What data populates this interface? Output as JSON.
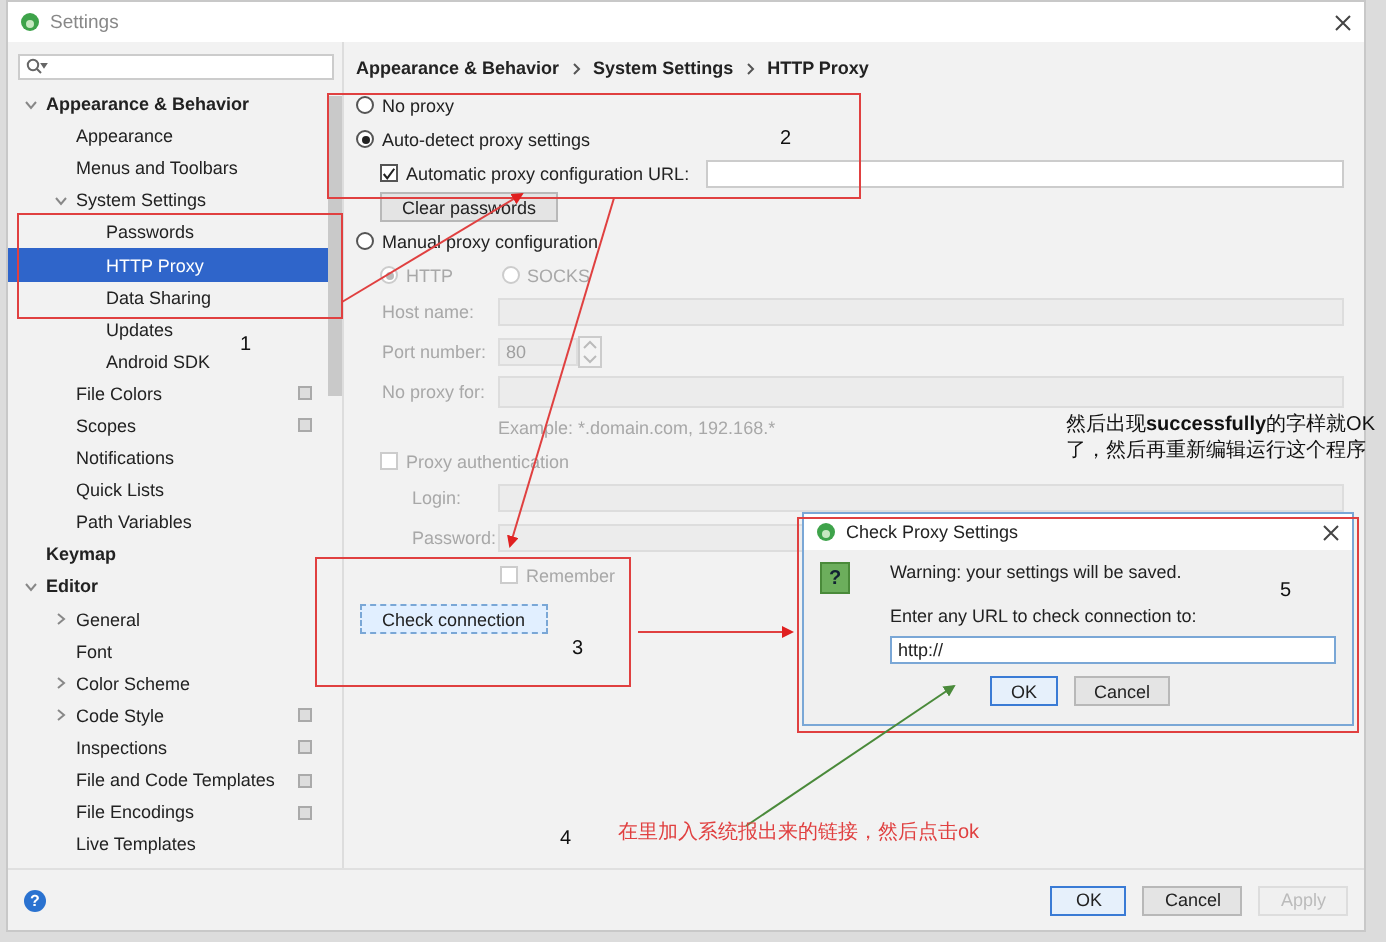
{
  "window": {
    "title": "Settings"
  },
  "sidebar": {
    "tree": [
      {
        "label": "Appearance & Behavior",
        "expanded": true,
        "children": [
          {
            "label": "Appearance",
            "selected": false,
            "project_scoped": false
          },
          {
            "label": "Menus and Toolbars",
            "selected": false,
            "project_scoped": false
          },
          {
            "label": "System Settings",
            "expanded": true,
            "children": [
              {
                "label": "Passwords",
                "selected": false,
                "project_scoped": false
              },
              {
                "label": "HTTP Proxy",
                "selected": true,
                "project_scoped": false
              },
              {
                "label": "Data Sharing",
                "selected": false,
                "project_scoped": false
              },
              {
                "label": "Updates",
                "selected": false,
                "project_scoped": false
              },
              {
                "label": "Android SDK",
                "selected": false,
                "project_scoped": false
              }
            ]
          },
          {
            "label": "File Colors",
            "selected": false,
            "project_scoped": true
          },
          {
            "label": "Scopes",
            "selected": false,
            "project_scoped": true
          },
          {
            "label": "Notifications",
            "selected": false,
            "project_scoped": false
          },
          {
            "label": "Quick Lists",
            "selected": false,
            "project_scoped": false
          },
          {
            "label": "Path Variables",
            "selected": false,
            "project_scoped": false
          }
        ]
      },
      {
        "label": "Keymap",
        "selected": false,
        "project_scoped": false
      },
      {
        "label": "Editor",
        "expanded": true,
        "children": [
          {
            "label": "General",
            "expanded": false,
            "selected": false,
            "project_scoped": false
          },
          {
            "label": "Font",
            "selected": false,
            "project_scoped": false
          },
          {
            "label": "Color Scheme",
            "expanded": false,
            "selected": false,
            "project_scoped": false
          },
          {
            "label": "Code Style",
            "expanded": false,
            "selected": false,
            "project_scoped": true
          },
          {
            "label": "Inspections",
            "selected": false,
            "project_scoped": true
          },
          {
            "label": "File and Code Templates",
            "selected": false,
            "project_scoped": true
          },
          {
            "label": "File Encodings",
            "selected": false,
            "project_scoped": true
          },
          {
            "label": "Live Templates",
            "selected": false,
            "project_scoped": false
          }
        ]
      }
    ]
  },
  "breadcrumb": [
    "Appearance & Behavior",
    "System Settings",
    "HTTP Proxy"
  ],
  "proxy_modes": [
    {
      "label": "No proxy",
      "selected": false
    },
    {
      "label": "Auto-detect proxy settings",
      "selected": true
    },
    {
      "label": "Manual proxy configuration",
      "selected": false
    }
  ],
  "auto_config": {
    "label": "Automatic proxy configuration URL:",
    "checked": true
  },
  "clear_passwords_button": "Clear passwords",
  "manual": {
    "disabled": true,
    "types": [
      {
        "label": "HTTP",
        "selected": true
      },
      {
        "label": "SOCKS",
        "selected": false
      }
    ],
    "host_label": "Host name:",
    "port_label": "Port number:",
    "port_value": "80",
    "no_proxy_label": "No proxy for:",
    "example": "Example: *.domain.com, 192.168.*",
    "auth": {
      "label": "Proxy authentication",
      "checked": false
    },
    "login_label": "Login:",
    "password_label": "Password:",
    "remember": {
      "label": "Remember",
      "checked": false
    }
  },
  "check_connection_button": "Check connection",
  "footer": {
    "help": "?",
    "buttons": [
      {
        "label": "OK",
        "kind": "default",
        "disabled": false
      },
      {
        "label": "Cancel",
        "kind": "normal",
        "disabled": false
      },
      {
        "label": "Apply",
        "kind": "normal",
        "disabled": true
      }
    ]
  },
  "dialog": {
    "title": "Check Proxy Settings",
    "icon": "?",
    "warning": "Warning: your settings will be saved.",
    "prompt": "Enter any URL to check connection to:",
    "url": "http://",
    "buttons": [
      {
        "label": "OK",
        "kind": "default"
      },
      {
        "label": "Cancel",
        "kind": "normal"
      }
    ]
  },
  "annotations": [
    {
      "kind": "number",
      "text": "1"
    },
    {
      "kind": "number",
      "text": "2"
    },
    {
      "kind": "number",
      "text": "3"
    },
    {
      "kind": "number",
      "text": "4"
    },
    {
      "kind": "number",
      "text": "5"
    },
    {
      "kind": "note",
      "text": "然后出现**successfully**的字样就OK了，然后再重新编辑运行这个程序"
    },
    {
      "kind": "red_note",
      "text": "在里加入系统报出来的链接，然后点击ok"
    }
  ]
}
